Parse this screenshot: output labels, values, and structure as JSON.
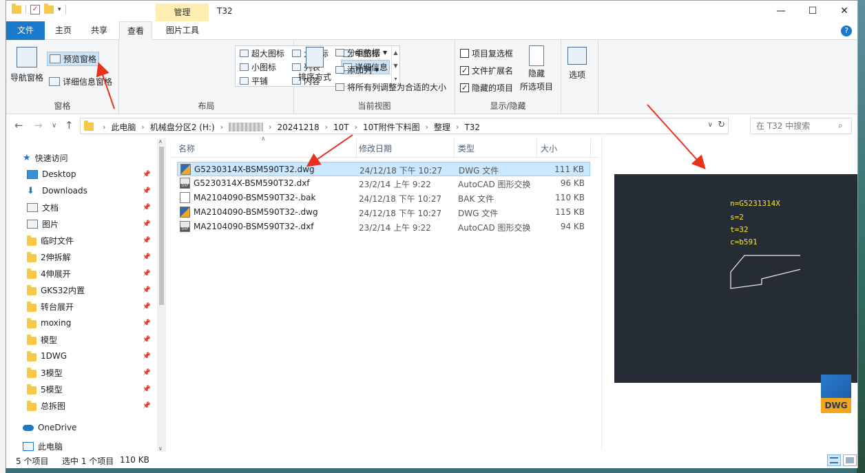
{
  "window": {
    "title": "T32",
    "context_tab": "管理",
    "minimize_glyph": "—",
    "maximize_glyph": "☐",
    "close_glyph": "✕"
  },
  "ribbon_tabs": [
    {
      "label": "文件"
    },
    {
      "label": "主页"
    },
    {
      "label": "共享"
    },
    {
      "label": "查看"
    },
    {
      "label": "图片工具"
    }
  ],
  "help_glyph": "?",
  "ribbon": {
    "panes": {
      "nav_pane_label": "导航窗格",
      "preview_pane_label": "预览窗格",
      "details_pane_label": "详细信息窗格",
      "group_label": "窗格"
    },
    "layout": {
      "options": [
        "超大图标",
        "大图标",
        "中图标",
        "小图标",
        "列表",
        "详细信息",
        "平铺",
        "内容"
      ],
      "group_label": "布局"
    },
    "current_view": {
      "sort_label": "排序方式",
      "group_by_label": "分组依据",
      "add_column_label": "添加列",
      "fit_columns_label": "将所有列调整为合适的大小",
      "group_label": "当前视图"
    },
    "show_hide": {
      "item_checkboxes_label": "项目复选框",
      "item_checkboxes_checked": false,
      "extensions_label": "文件扩展名",
      "extensions_checked": true,
      "hidden_items_label": "隐藏的项目",
      "hidden_items_checked": true,
      "hide_selected_line1": "隐藏",
      "hide_selected_line2": "所选项目",
      "group_label": "显示/隐藏"
    },
    "options_label": "选项"
  },
  "address": {
    "crumbs": [
      "此电脑",
      "机械盘分区2 (H:)",
      "",
      "20241218",
      "10T",
      "10T附件下料图",
      "整理",
      "T32"
    ],
    "search_placeholder": "在 T32 中搜索"
  },
  "nav_pane": {
    "quick_access_label": "快速访问",
    "items": [
      {
        "label": "Desktop",
        "icon": "desktop-icon"
      },
      {
        "label": "Downloads",
        "icon": "downloads-icon"
      },
      {
        "label": "文档",
        "icon": "documents-icon"
      },
      {
        "label": "图片",
        "icon": "pictures-icon"
      },
      {
        "label": "临时文件",
        "icon": "folder-icon"
      },
      {
        "label": "2伸拆解",
        "icon": "folder-icon"
      },
      {
        "label": "4伸展开",
        "icon": "folder-icon"
      },
      {
        "label": "GKS32内置",
        "icon": "folder-icon"
      },
      {
        "label": "转台展开",
        "icon": "folder-icon"
      },
      {
        "label": "moxing",
        "icon": "folder-icon"
      },
      {
        "label": "模型",
        "icon": "folder-icon"
      },
      {
        "label": "1DWG",
        "icon": "folder-icon"
      },
      {
        "label": "3模型",
        "icon": "folder-icon"
      },
      {
        "label": "5模型",
        "icon": "folder-icon"
      },
      {
        "label": "总拆图",
        "icon": "folder-icon"
      }
    ],
    "onedrive_label": "OneDrive",
    "thispc_label": "此电脑"
  },
  "file_list": {
    "columns": [
      "名称",
      "修改日期",
      "类型",
      "大小"
    ],
    "rows": [
      {
        "name": "G5230314X-BSM590T32.dwg",
        "date": "24/12/18 下午 10:27",
        "type": "DWG 文件",
        "size": "111 KB",
        "icon": "dwg"
      },
      {
        "name": "G5230314X-BSM590T32.dxf",
        "date": "23/2/14 上午 9:22",
        "type": "AutoCAD 图形交换",
        "size": "96 KB",
        "icon": "dxf"
      },
      {
        "name": "MA2104090-BSM590T32-.bak",
        "date": "24/12/18 下午 10:27",
        "type": "BAK 文件",
        "size": "110 KB",
        "icon": "bak"
      },
      {
        "name": "MA2104090-BSM590T32-.dwg",
        "date": "24/12/18 下午 10:27",
        "type": "DWG 文件",
        "size": "115 KB",
        "icon": "dwg"
      },
      {
        "name": "MA2104090-BSM590T32-.dxf",
        "date": "23/2/14 上午 9:22",
        "type": "AutoCAD 图形交换",
        "size": "94 KB",
        "icon": "dxf"
      }
    ]
  },
  "preview": {
    "lines": [
      "n=G5231314X",
      "s=2",
      "t=32",
      "c=b591"
    ],
    "logo_text": "DWG",
    "bg_color": "#262c35",
    "text_color": "#f4e53a"
  },
  "status": {
    "item_count": "5 个项目",
    "selected": "选中 1 个项目",
    "selected_size": "110 KB"
  },
  "annotation_color": "#e8321e"
}
